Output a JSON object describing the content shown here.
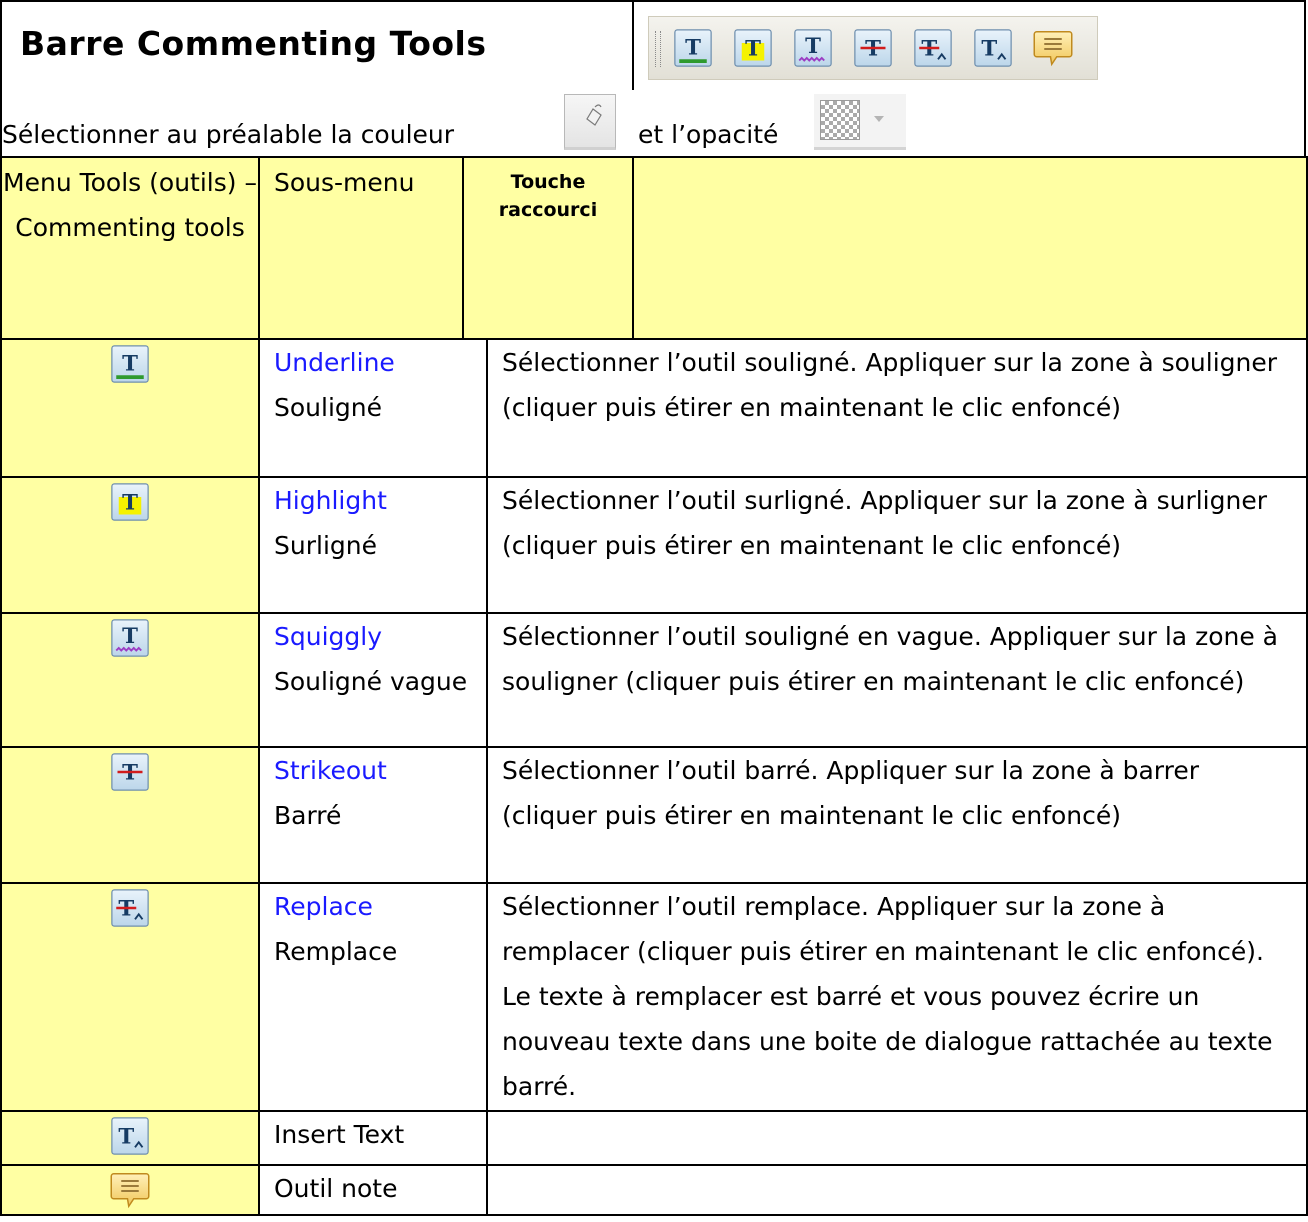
{
  "header": {
    "title": "Barre Commenting Tools",
    "toolbar_icons": [
      "underline-icon",
      "highlight-icon",
      "squiggly-icon",
      "strikeout-icon",
      "replace-icon",
      "insert-text-icon",
      "note-icon"
    ]
  },
  "instruction": {
    "text_before": "Sélectionner au préalable la couleur",
    "text_after": "et l’opacité"
  },
  "table": {
    "headers": {
      "menu": "Menu Tools (outils) – Commenting tools",
      "submenu": "Sous-menu",
      "shortcut": "Touche raccourci"
    },
    "rows": [
      {
        "icon": "underline-icon",
        "name": "Underline",
        "label": "Souligné",
        "description": "Sélectionner l’outil souligné. Appliquer sur la zone à souligner (cliquer puis étirer en maintenant le clic enfoncé)"
      },
      {
        "icon": "highlight-icon",
        "name": "Highlight",
        "label": "Surligné",
        "description": "Sélectionner l’outil surligné. Appliquer sur la zone à surligner (cliquer puis étirer en maintenant le clic enfoncé)"
      },
      {
        "icon": "squiggly-icon",
        "name": "Squiggly",
        "label": "Souligné vague",
        "description": "Sélectionner l’outil souligné en vague. Appliquer sur la zone à souligner (cliquer puis étirer en maintenant le clic enfoncé)"
      },
      {
        "icon": "strikeout-icon",
        "name": "Strikeout",
        "label": "Barré",
        "description": "Sélectionner l’outil barré. Appliquer sur la zone à barrer (cliquer puis étirer en maintenant le clic enfoncé)"
      },
      {
        "icon": "replace-icon",
        "name": "Replace",
        "label": "Remplace",
        "description": "Sélectionner l’outil remplace. Appliquer sur la zone à remplacer (cliquer puis étirer en maintenant le clic enfoncé). Le texte à remplacer est barré et vous pouvez écrire un nouveau texte dans une boite de dialogue rattachée au texte barré."
      },
      {
        "icon": "insert-text-icon",
        "name": "",
        "label": "Insert Text",
        "description": ""
      },
      {
        "icon": "note-icon",
        "name": "",
        "label": "Outil note",
        "description": ""
      }
    ]
  },
  "colors": {
    "highlight_cell": "#ffffa3",
    "link_text": "#1a1aff",
    "underline_green": "#2e9a2e",
    "strike_red": "#d21c1c",
    "squiggly_purple": "#9c3dc4",
    "note_yellow": "#f6d373"
  }
}
